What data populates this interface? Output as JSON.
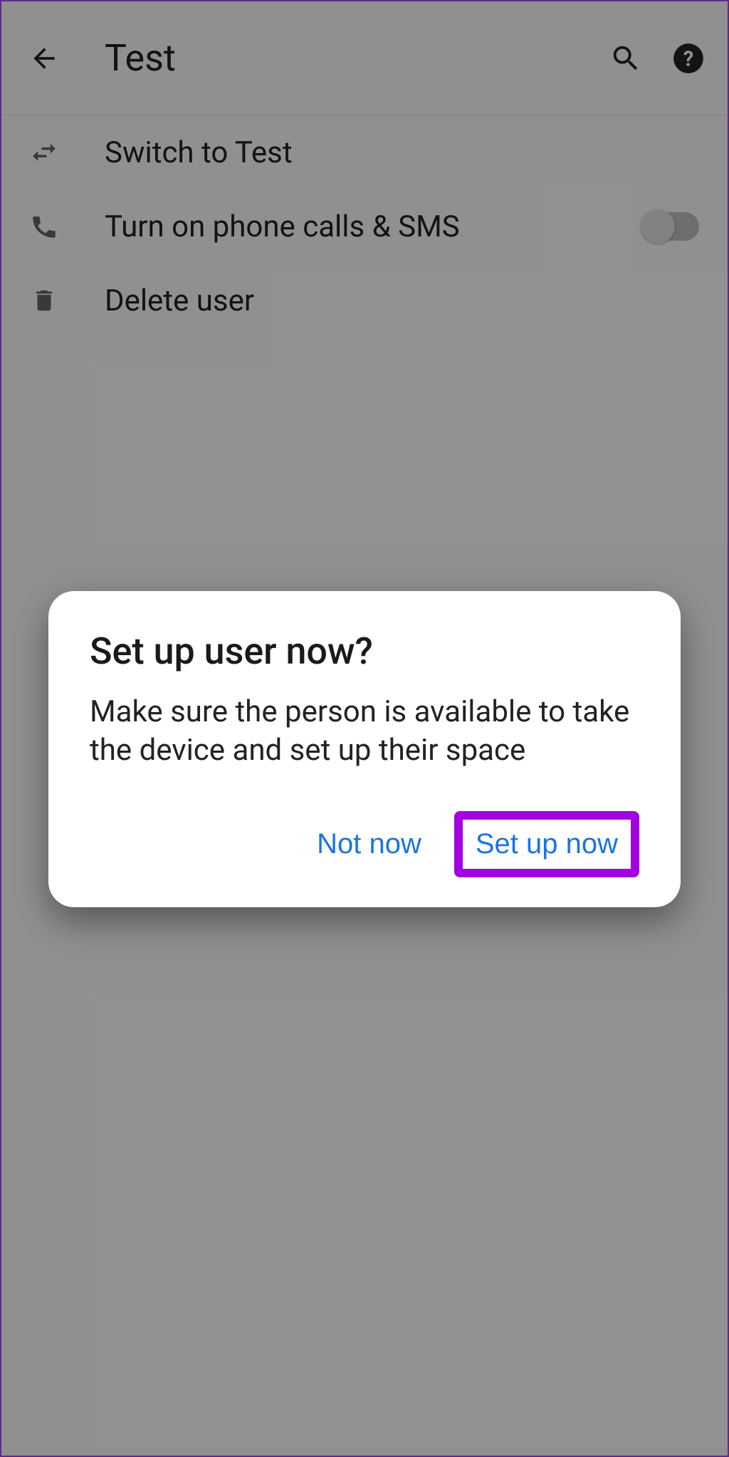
{
  "header": {
    "title": "Test"
  },
  "options": {
    "switch_label": "Switch to Test",
    "calls_label": "Turn on phone calls & SMS",
    "delete_label": "Delete user"
  },
  "dialog": {
    "title": "Set up user now?",
    "body": "Make sure the person is available to take the device and set up their space",
    "not_now": "Not now",
    "set_up_now": "Set up now"
  },
  "colors": {
    "highlight": "#a300e0",
    "link": "#1a73e8"
  }
}
